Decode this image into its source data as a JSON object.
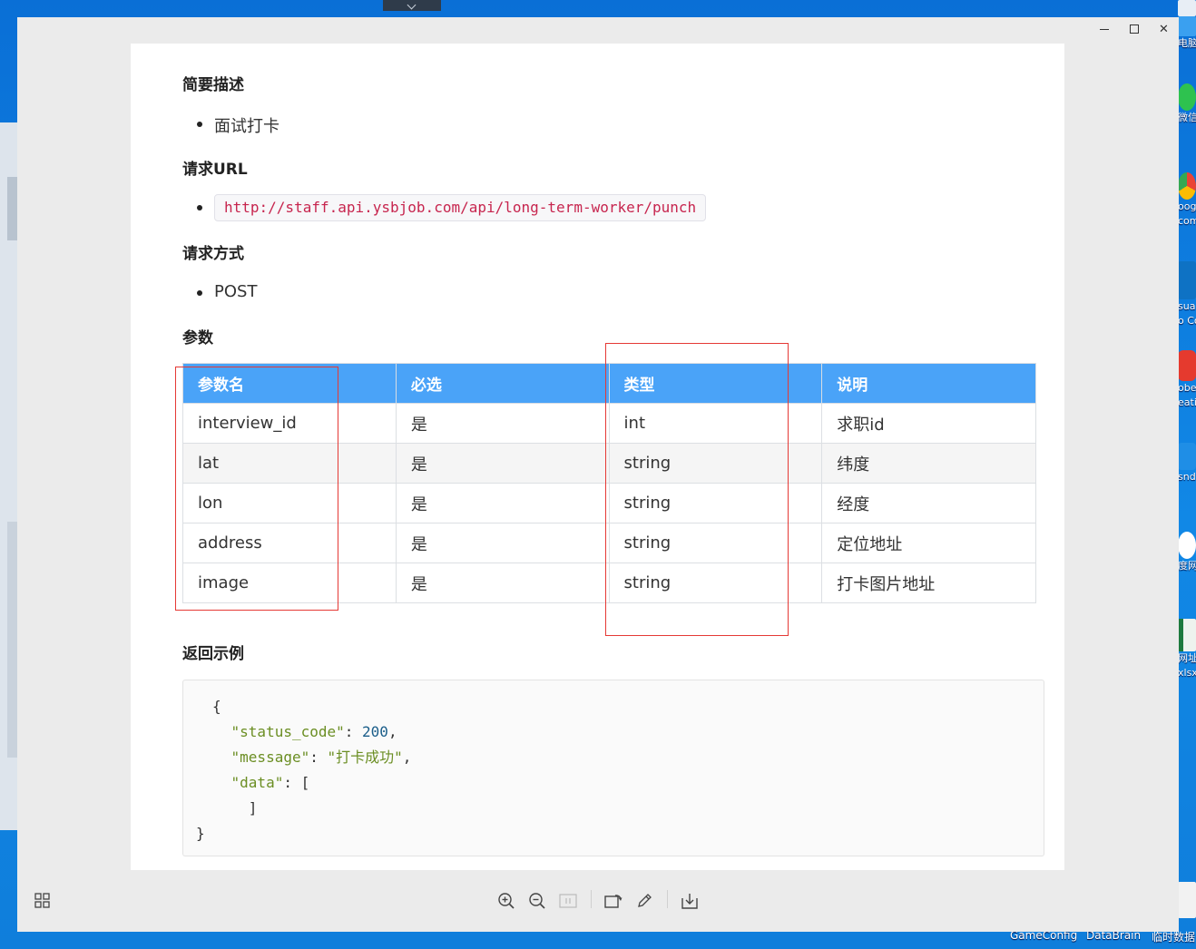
{
  "desktop": {
    "icons": [
      {
        "name": "recycle-bin",
        "label": ""
      },
      {
        "name": "this-pc",
        "label": "电脑"
      },
      {
        "name": "wechat",
        "label": "微信"
      },
      {
        "name": "chrome",
        "label": "oogle\ncom"
      },
      {
        "name": "vscode",
        "label": "sual\no Co"
      },
      {
        "name": "adobe",
        "label": "obe\neati"
      },
      {
        "name": "app",
        "label": "snd"
      },
      {
        "name": "browser",
        "label": "度网盘"
      },
      {
        "name": "excel",
        "label": "网址\nxlsx"
      }
    ],
    "taskbar_items": [
      "GameConfig",
      "DataBrain",
      "临时数据"
    ]
  },
  "window": {
    "controls": {
      "minimize": "–",
      "maximize": "□",
      "close": "✕"
    }
  },
  "doc": {
    "sections": {
      "desc_title": "简要描述",
      "desc_item": "面试打卡",
      "url_title": "请求URL",
      "url_value": "http://staff.api.ysbjob.com/api/long-term-worker/punch",
      "method_title": "请求方式",
      "method_value": "POST",
      "params_title": "参数",
      "return_title": "返回示例"
    },
    "table": {
      "headers": [
        "参数名",
        "必选",
        "类型",
        "说明"
      ],
      "rows": [
        [
          "interview_id",
          "是",
          "int",
          "求职id"
        ],
        [
          "lat",
          "是",
          "string",
          "纬度"
        ],
        [
          "lon",
          "是",
          "string",
          "经度"
        ],
        [
          "address",
          "是",
          "string",
          "定位地址"
        ],
        [
          "image",
          "是",
          "string",
          "打卡图片地址"
        ]
      ]
    },
    "return_example": {
      "open_brace": "{",
      "status_code_key": "\"status_code\"",
      "status_code_value": "200",
      "message_key": "\"message\"",
      "message_value": "\"打卡成功\"",
      "data_key": "\"data\"",
      "data_open": "[",
      "data_close": "]",
      "close_brace": "}"
    }
  },
  "toolbar": {
    "icons": [
      "grid-icon",
      "zoom-in-icon",
      "zoom-out-icon",
      "actual-size-icon",
      "rotate-icon",
      "edit-icon",
      "save-icon"
    ]
  },
  "colors": {
    "table_header": "#4aa3f8",
    "annotation": "#e53935",
    "url_text": "#c7254e"
  }
}
